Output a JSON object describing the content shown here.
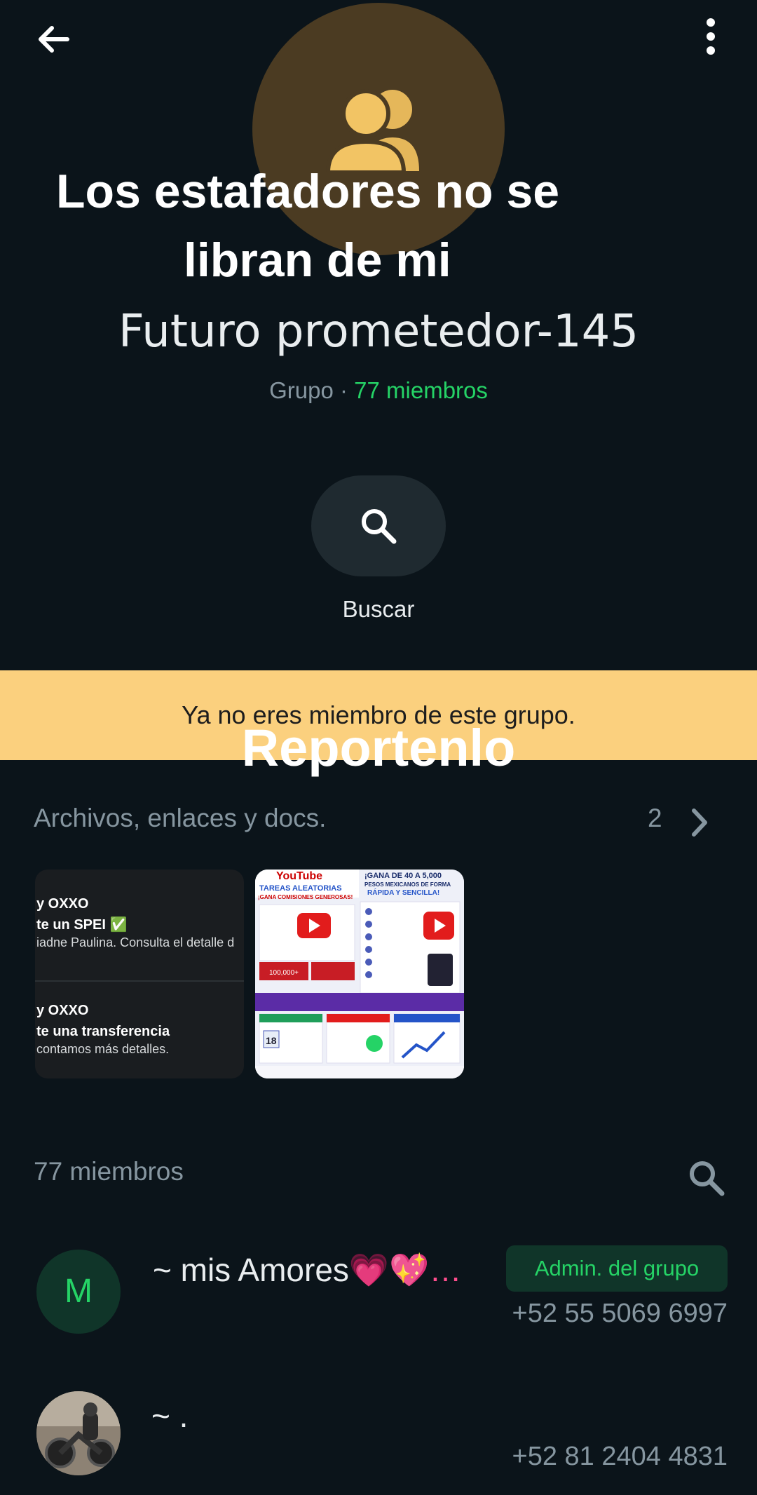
{
  "header": {
    "back_icon": "arrow-left-icon",
    "menu_icon": "more-vert-icon"
  },
  "overlay_caption": {
    "line1": "Los estafadores no se",
    "line2": "libran de mi"
  },
  "group": {
    "avatar_icon": "group-icon",
    "name": "Futuro prometedor-145",
    "type": "Grupo",
    "separator": "·",
    "members": "77 miembros"
  },
  "actions": {
    "search_label": "Buscar"
  },
  "banner": {
    "text": "Ya no eres miembro de este grupo."
  },
  "overlay_caption_2": "Reportenlo",
  "files": {
    "title": "Archivos, enlaces y docs.",
    "count": "2",
    "thumb1": {
      "card1_title": "y OXXO",
      "card1_sub": "te un SPEI ✅",
      "card1_text": "iadne Paulina. Consulta el detalle d",
      "card2_title": "y OXXO",
      "card2_sub": "te una transferencia",
      "card2_text": "contamos más detalles."
    },
    "thumb2": {
      "youtube": "YouTube",
      "tareas": "TAREAS ALEATORIAS",
      "comisiones": "¡GANA COMISIONES GENEROSAS!",
      "gana": "¡GANA DE 40 A 5,000",
      "pesos": "PESOS MEXICANOS DE FORMA",
      "rapida": "RÁPIDA Y SENCILLA!",
      "stat": "100,000+",
      "day": "18"
    }
  },
  "members_section": {
    "title": "77 miembros",
    "search_icon": "search-icon"
  },
  "members": [
    {
      "initial": "M",
      "name": "~ mis Amores",
      "emoji": "💗💖…",
      "badge": "Admin. del grupo",
      "phone": "+52 55 5069 6997"
    },
    {
      "name": "~ .",
      "phone": "+52 81 2404 4831"
    }
  ],
  "colors": {
    "background": "#0b141a",
    "accent_green": "#25d366",
    "banner": "#fbd07e"
  }
}
